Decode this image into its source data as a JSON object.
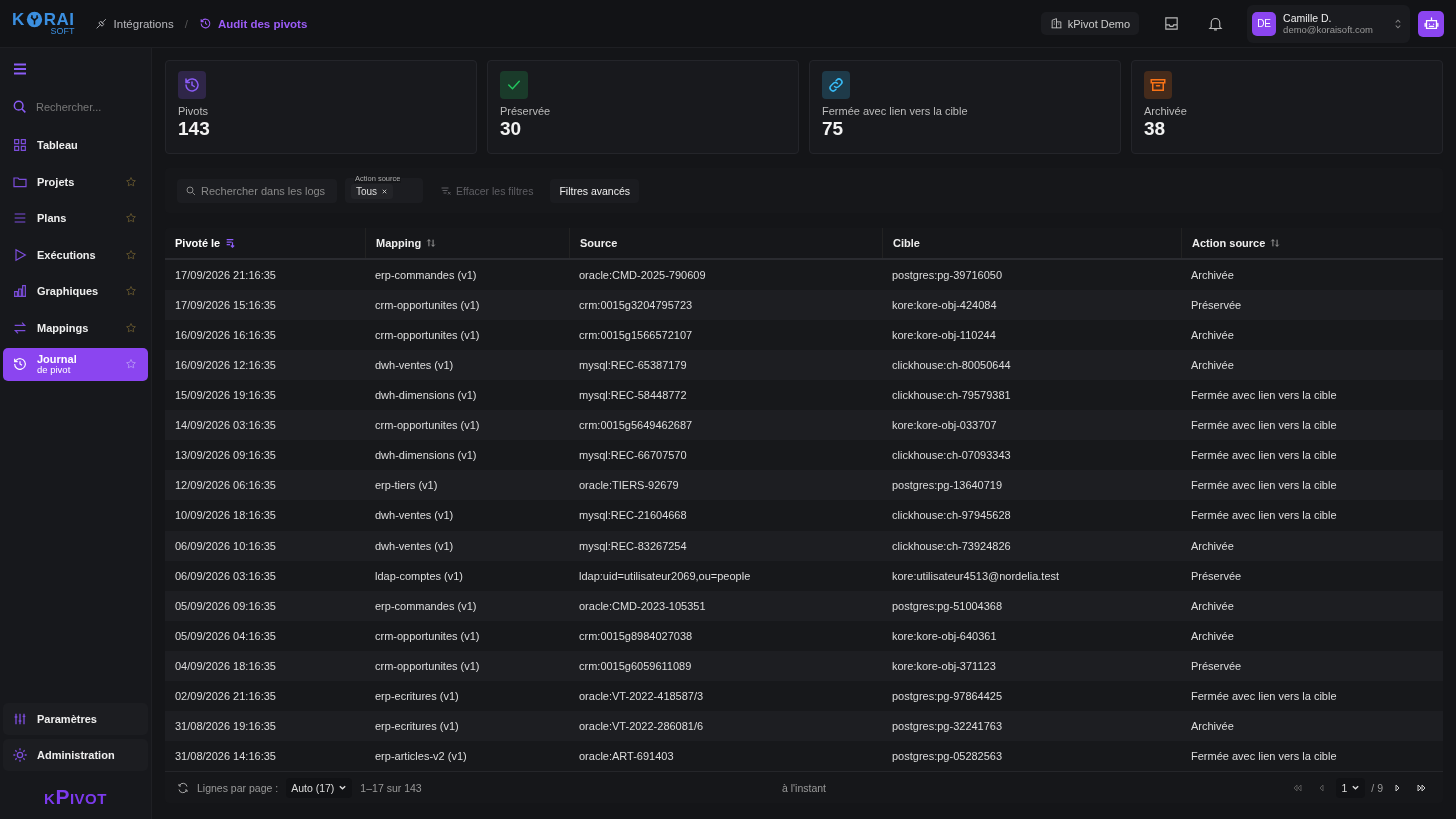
{
  "header": {
    "logo": {
      "left": "K",
      "right": "RAI",
      "sub": "SOFT"
    },
    "separator": "/",
    "breadcrumb": [
      {
        "label": "Intégrations",
        "current": false
      },
      {
        "label": "Audit des pivots",
        "current": true
      }
    ],
    "workspace": "kPivot Demo",
    "user": {
      "initials": "DE",
      "name": "Camille D.",
      "email": "demo@koraisoft.com"
    }
  },
  "sidebar": {
    "search_placeholder": "Rechercher...",
    "items": [
      {
        "label": "Tableau",
        "star": false,
        "selected": false
      },
      {
        "label": "Projets",
        "star": true,
        "selected": false
      },
      {
        "label": "Plans",
        "star": true,
        "selected": false
      },
      {
        "label": "Exécutions",
        "star": true,
        "selected": false
      },
      {
        "label": "Graphiques",
        "star": true,
        "selected": false
      },
      {
        "label": "Mappings",
        "star": true,
        "selected": false
      },
      {
        "label": "Journal",
        "sublabel": "de pivot",
        "star": true,
        "selected": true
      }
    ],
    "bottom": [
      "Paramètres",
      "Administration"
    ],
    "brand": "kPivot"
  },
  "stats": [
    {
      "label": "Pivots",
      "value": "143",
      "color": "#8b5cf6"
    },
    {
      "label": "Préservée",
      "value": "30",
      "color": "#22c55e"
    },
    {
      "label": "Fermée avec lien vers la cible",
      "value": "75",
      "color": "#38bdf8"
    },
    {
      "label": "Archivée",
      "value": "38",
      "color": "#f97316"
    }
  ],
  "filters": {
    "search_placeholder": "Rechercher dans les logs",
    "action_label": "Action source",
    "action_value": "Tous",
    "clear": "Effacer les filtres",
    "clear_disabled": true,
    "advanced": "Filtres avancés"
  },
  "table": {
    "columns": [
      {
        "label": "Pivoté le",
        "sortable": true,
        "sorted": true
      },
      {
        "label": "Mapping",
        "sortable": true,
        "sorted": false
      },
      {
        "label": "Source",
        "sortable": false,
        "sorted": false
      },
      {
        "label": "Cible",
        "sortable": false,
        "sorted": false
      },
      {
        "label": "Action source",
        "sortable": true,
        "sorted": false
      }
    ],
    "rows": [
      [
        "17/09/2026 21:16:35",
        "erp-commandes (v1)",
        "oracle:CMD-2025-790609",
        "postgres:pg-39716050",
        "Archivée"
      ],
      [
        "17/09/2026 15:16:35",
        "crm-opportunites (v1)",
        "crm:0015g3204795723",
        "kore:kore-obj-424084",
        "Préservée"
      ],
      [
        "16/09/2026 16:16:35",
        "crm-opportunites (v1)",
        "crm:0015g1566572107",
        "kore:kore-obj-110244",
        "Archivée"
      ],
      [
        "16/09/2026 12:16:35",
        "dwh-ventes (v1)",
        "mysql:REC-65387179",
        "clickhouse:ch-80050644",
        "Archivée"
      ],
      [
        "15/09/2026 19:16:35",
        "dwh-dimensions (v1)",
        "mysql:REC-58448772",
        "clickhouse:ch-79579381",
        "Fermée avec lien vers la cible"
      ],
      [
        "14/09/2026 03:16:35",
        "crm-opportunites (v1)",
        "crm:0015g5649462687",
        "kore:kore-obj-033707",
        "Fermée avec lien vers la cible"
      ],
      [
        "13/09/2026 09:16:35",
        "dwh-dimensions (v1)",
        "mysql:REC-66707570",
        "clickhouse:ch-07093343",
        "Fermée avec lien vers la cible"
      ],
      [
        "12/09/2026 06:16:35",
        "erp-tiers (v1)",
        "oracle:TIERS-92679",
        "postgres:pg-13640719",
        "Fermée avec lien vers la cible"
      ],
      [
        "10/09/2026 18:16:35",
        "dwh-ventes (v1)",
        "mysql:REC-21604668",
        "clickhouse:ch-97945628",
        "Fermée avec lien vers la cible"
      ],
      [
        "06/09/2026 10:16:35",
        "dwh-ventes (v1)",
        "mysql:REC-83267254",
        "clickhouse:ch-73924826",
        "Archivée"
      ],
      [
        "06/09/2026 03:16:35",
        "ldap-comptes (v1)",
        "ldap:uid=utilisateur2069,ou=people",
        "kore:utilisateur4513@nordelia.test",
        "Préservée"
      ],
      [
        "05/09/2026 09:16:35",
        "erp-commandes (v1)",
        "oracle:CMD-2023-105351",
        "postgres:pg-51004368",
        "Archivée"
      ],
      [
        "05/09/2026 04:16:35",
        "crm-opportunites (v1)",
        "crm:0015g8984027038",
        "kore:kore-obj-640361",
        "Archivée"
      ],
      [
        "04/09/2026 18:16:35",
        "crm-opportunites (v1)",
        "crm:0015g6059611089",
        "kore:kore-obj-371123",
        "Préservée"
      ],
      [
        "02/09/2026 21:16:35",
        "erp-ecritures (v1)",
        "oracle:VT-2022-418587/3",
        "postgres:pg-97864425",
        "Fermée avec lien vers la cible"
      ],
      [
        "31/08/2026 19:16:35",
        "erp-ecritures (v1)",
        "oracle:VT-2022-286081/6",
        "postgres:pg-32241763",
        "Archivée"
      ],
      [
        "31/08/2026 14:16:35",
        "erp-articles-v2 (v1)",
        "oracle:ART-691403",
        "postgres:pg-05282563",
        "Fermée avec lien vers la cible"
      ]
    ]
  },
  "footer": {
    "rows_label": "Lignes par page :",
    "rows_value": "Auto (17)",
    "range": "1–17 sur 143",
    "updated": "à l'instant",
    "page": "1",
    "pages": "/ 9",
    "first_disabled": true,
    "prev_disabled": true
  }
}
